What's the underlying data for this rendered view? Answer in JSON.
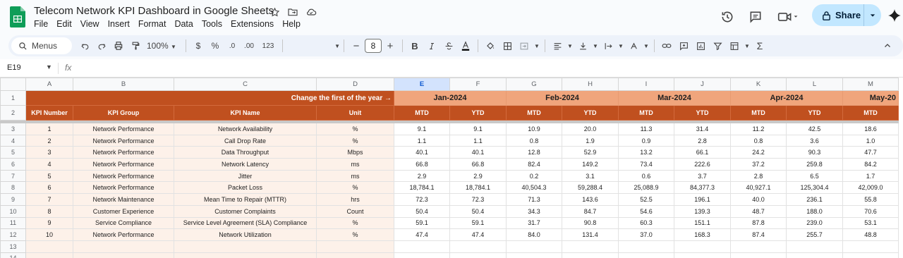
{
  "app": {
    "title": "Telecom Network KPI Dashboard in Google Sheets",
    "menus": [
      "File",
      "Edit",
      "View",
      "Insert",
      "Format",
      "Data",
      "Tools",
      "Extensions",
      "Help"
    ],
    "share_label": "Share",
    "brand_color": "#0f9d58"
  },
  "toolbar": {
    "menus_label": "Menus",
    "zoom": "100%",
    "currency": "$",
    "percent": "%",
    "dec_decrease": ".0",
    "dec_increase": ".00",
    "number_format": "123",
    "font_size": "8",
    "minus": "−",
    "plus": "+",
    "bold": "B"
  },
  "formula_bar": {
    "cell_ref": "E19",
    "fx": "fx"
  },
  "sheet": {
    "column_letters": [
      "A",
      "B",
      "C",
      "D",
      "E",
      "F",
      "G",
      "H",
      "I",
      "J",
      "K",
      "L",
      "M"
    ],
    "selected_column": "E",
    "row_numbers": [
      "1",
      "2",
      "3",
      "4",
      "5",
      "6",
      "7",
      "8",
      "9",
      "10",
      "11",
      "12",
      "13",
      "14"
    ],
    "change_label": "Change the first of the year →",
    "months": [
      "Jan-2024",
      "Feb-2024",
      "Mar-2024",
      "Apr-2024",
      "May-20"
    ],
    "headers": {
      "kpi_number": "KPI Number",
      "kpi_group": "KPI Group",
      "kpi_name": "KPI Name",
      "unit": "Unit",
      "mtd": "MTD",
      "ytd": "YTD"
    },
    "header_color": "#c0501f",
    "month_color": "#f0a57c",
    "rows": [
      {
        "n": "1",
        "group": "Network Performance",
        "name": "Network Availability",
        "unit": "%",
        "vals": [
          "9.1",
          "9.1",
          "10.9",
          "20.0",
          "11.3",
          "31.4",
          "11.2",
          "42.5",
          "18.6"
        ]
      },
      {
        "n": "2",
        "group": "Network Performance",
        "name": "Call Drop Rate",
        "unit": "%",
        "vals": [
          "1.1",
          "1.1",
          "0.8",
          "1.9",
          "0.9",
          "2.8",
          "0.8",
          "3.6",
          "1.0"
        ]
      },
      {
        "n": "3",
        "group": "Network Performance",
        "name": "Data Throughput",
        "unit": "Mbps",
        "vals": [
          "40.1",
          "40.1",
          "12.8",
          "52.9",
          "13.2",
          "66.1",
          "24.2",
          "90.3",
          "47.7"
        ]
      },
      {
        "n": "4",
        "group": "Network Performance",
        "name": "Network Latency",
        "unit": "ms",
        "vals": [
          "66.8",
          "66.8",
          "82.4",
          "149.2",
          "73.4",
          "222.6",
          "37.2",
          "259.8",
          "84.2"
        ]
      },
      {
        "n": "5",
        "group": "Network Performance",
        "name": "Jitter",
        "unit": "ms",
        "vals": [
          "2.9",
          "2.9",
          "0.2",
          "3.1",
          "0.6",
          "3.7",
          "2.8",
          "6.5",
          "1.7"
        ]
      },
      {
        "n": "6",
        "group": "Network Performance",
        "name": "Packet Loss",
        "unit": "%",
        "vals": [
          "18,784.1",
          "18,784.1",
          "40,504.3",
          "59,288.4",
          "25,088.9",
          "84,377.3",
          "40,927.1",
          "125,304.4",
          "42,009.0"
        ]
      },
      {
        "n": "7",
        "group": "Network Maintenance",
        "name": "Mean Time to Repair (MTTR)",
        "unit": "hrs",
        "vals": [
          "72.3",
          "72.3",
          "71.3",
          "143.6",
          "52.5",
          "196.1",
          "40.0",
          "236.1",
          "55.8"
        ]
      },
      {
        "n": "8",
        "group": "Customer Experience",
        "name": "Customer Complaints",
        "unit": "Count",
        "vals": [
          "50.4",
          "50.4",
          "34.3",
          "84.7",
          "54.6",
          "139.3",
          "48.7",
          "188.0",
          "70.6"
        ]
      },
      {
        "n": "9",
        "group": "Service Compliance",
        "name": "Service Level Agreement (SLA) Compliance",
        "unit": "%",
        "vals": [
          "59.1",
          "59.1",
          "31.7",
          "90.8",
          "60.3",
          "151.1",
          "87.8",
          "239.0",
          "53.1"
        ]
      },
      {
        "n": "10",
        "group": "Network Performance",
        "name": "Network Utilization",
        "unit": "%",
        "vals": [
          "47.4",
          "47.4",
          "84.0",
          "131.4",
          "37.0",
          "168.3",
          "87.4",
          "255.7",
          "48.8"
        ]
      }
    ]
  }
}
